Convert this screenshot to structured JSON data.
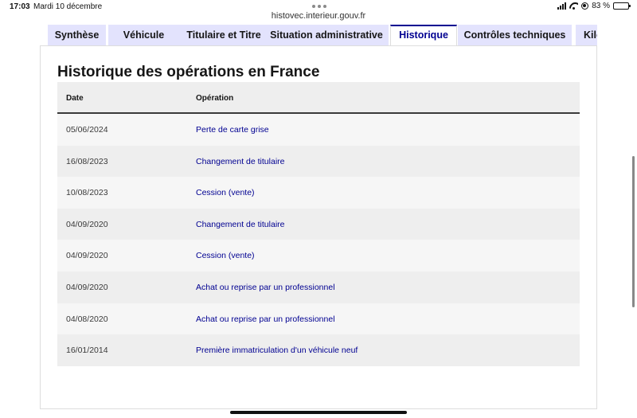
{
  "status_bar": {
    "time": "17:03",
    "date": "Mardi 10 décembre",
    "battery_percent": "83 %",
    "battery_level": 0.83
  },
  "browser": {
    "url": "histovec.interieur.gouv.fr"
  },
  "tabs": [
    {
      "label": "Synthèse",
      "active": false
    },
    {
      "label": "Véhicule",
      "active": false
    },
    {
      "label": "Titulaire et Titre",
      "active": false
    },
    {
      "label": "Situation administrative",
      "active": false
    },
    {
      "label": "Historique",
      "active": true
    },
    {
      "label": "Contrôles techniques",
      "active": false
    },
    {
      "label": "Kilo",
      "active": false
    }
  ],
  "section": {
    "title": "Historique des opérations en France"
  },
  "table": {
    "headers": {
      "date": "Date",
      "operation": "Opération"
    },
    "rows": [
      {
        "date": "05/06/2024",
        "operation": "Perte de carte grise"
      },
      {
        "date": "16/08/2023",
        "operation": "Changement de titulaire"
      },
      {
        "date": "10/08/2023",
        "operation": "Cession (vente)"
      },
      {
        "date": "04/09/2020",
        "operation": "Changement de titulaire"
      },
      {
        "date": "04/09/2020",
        "operation": "Cession (vente)"
      },
      {
        "date": "04/09/2020",
        "operation": "Achat ou reprise par un professionnel"
      },
      {
        "date": "04/08/2020",
        "operation": "Achat ou reprise par un professionnel"
      },
      {
        "date": "16/01/2014",
        "operation": "Première immatriculation d'un véhicule neuf"
      }
    ]
  },
  "colors": {
    "accent": "#000091",
    "tab_bg": "#e3e3fd",
    "table_header_bg": "#eeeeee"
  }
}
